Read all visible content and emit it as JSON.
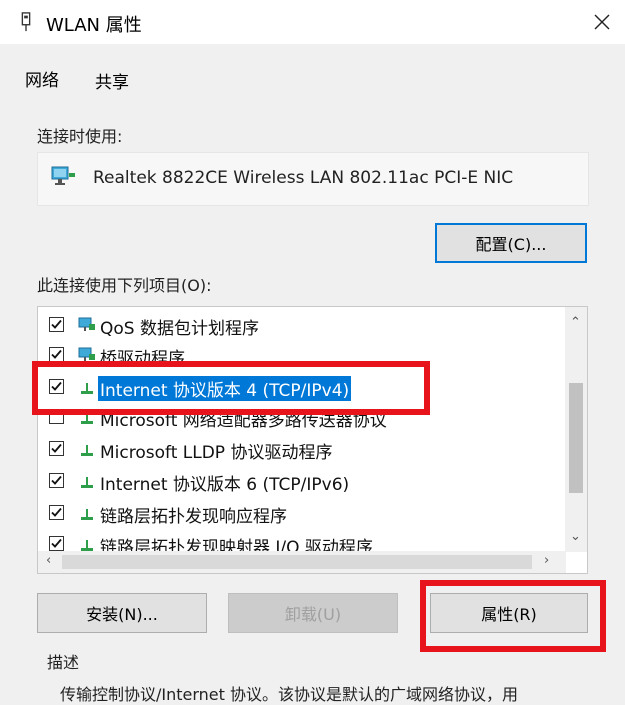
{
  "window": {
    "title": "WLAN 属性",
    "close_icon": "close-icon"
  },
  "tabs": [
    {
      "label": "网络"
    },
    {
      "label": "共享"
    }
  ],
  "connection": {
    "label": "连接时使用:",
    "adapter_name": "Realtek 8822CE Wireless LAN 802.11ac PCI-E NIC",
    "configure_button": "配置(C)..."
  },
  "items_section": {
    "label": "此连接使用下列项目(O):",
    "items": [
      {
        "label": "QoS 数据包计划程序",
        "checked": true,
        "icon": "network-service-icon"
      },
      {
        "label": "桥驱动程序",
        "checked": true,
        "icon": "network-service-icon"
      },
      {
        "label": "Internet 协议版本 4 (TCP/IPv4)",
        "checked": true,
        "selected": true,
        "icon": "protocol-icon"
      },
      {
        "label": "Microsoft 网络适配器多路传送器协议",
        "checked": false,
        "icon": "protocol-icon"
      },
      {
        "label": "Microsoft LLDP 协议驱动程序",
        "checked": true,
        "icon": "protocol-icon"
      },
      {
        "label": "Internet 协议版本 6 (TCP/IPv6)",
        "checked": true,
        "icon": "protocol-icon"
      },
      {
        "label": "链路层拓扑发现响应程序",
        "checked": true,
        "icon": "protocol-icon"
      },
      {
        "label": "链路层拓扑发现映射器 I/O 驱动程序",
        "checked": true,
        "icon": "protocol-icon"
      }
    ]
  },
  "buttons": {
    "install": "安装(N)...",
    "uninstall": "卸载(U)",
    "properties": "属性(R)"
  },
  "description": {
    "label": "描述",
    "text": "传输控制协议/Internet 协议。该协议是默认的广域网络协议，用"
  },
  "colors": {
    "highlight": "#e8141c",
    "selection": "#0078d7"
  }
}
